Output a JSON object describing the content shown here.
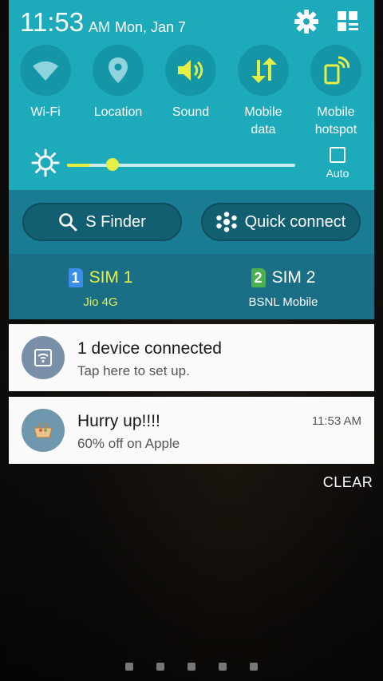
{
  "status": {
    "time": "11:53",
    "ampm": "AM",
    "date": "Mon, Jan 7",
    "settings_icon": "gear-icon",
    "edit_icon": "grid-edit-icon"
  },
  "quick_settings": {
    "toggles": [
      {
        "label": "Wi-Fi",
        "icon": "wifi-icon",
        "active": false
      },
      {
        "label": "Location",
        "icon": "location-pin-icon",
        "active": false
      },
      {
        "label": "Sound",
        "icon": "speaker-icon",
        "active": true
      },
      {
        "label": "Mobile\ndata",
        "icon": "data-arrows-icon",
        "active": true
      },
      {
        "label": "Mobile\nhotspot",
        "icon": "hotspot-icon",
        "active": true
      }
    ],
    "brightness": {
      "level": 0.1,
      "auto_label": "Auto",
      "auto_checked": false
    }
  },
  "actions": {
    "s_finder": "S Finder",
    "quick_connect": "Quick connect"
  },
  "sims": [
    {
      "number": "1",
      "name": "SIM 1",
      "carrier": "Jio 4G",
      "active": true,
      "color": "#e5f046",
      "badge_color": "#3a8ee8"
    },
    {
      "number": "2",
      "name": "SIM 2",
      "carrier": "BSNL Mobile",
      "active": false,
      "color": "#ffffff",
      "badge_color": "#4caf50"
    }
  ],
  "notifications": [
    {
      "title": "1 device connected",
      "subtitle": "Tap here to set up.",
      "time": "",
      "icon": "wifi-hotspot-icon",
      "icon_bg": "#7a8fa8"
    },
    {
      "title": "Hurry up!!!!",
      "subtitle": "60% off on Apple",
      "time": "11:53 AM",
      "icon": "basket-icon",
      "icon_bg": "#6f97ad"
    }
  ],
  "clear_label": "CLEAR",
  "colors": {
    "panel": "#1daabb",
    "accent": "#e5f046"
  }
}
